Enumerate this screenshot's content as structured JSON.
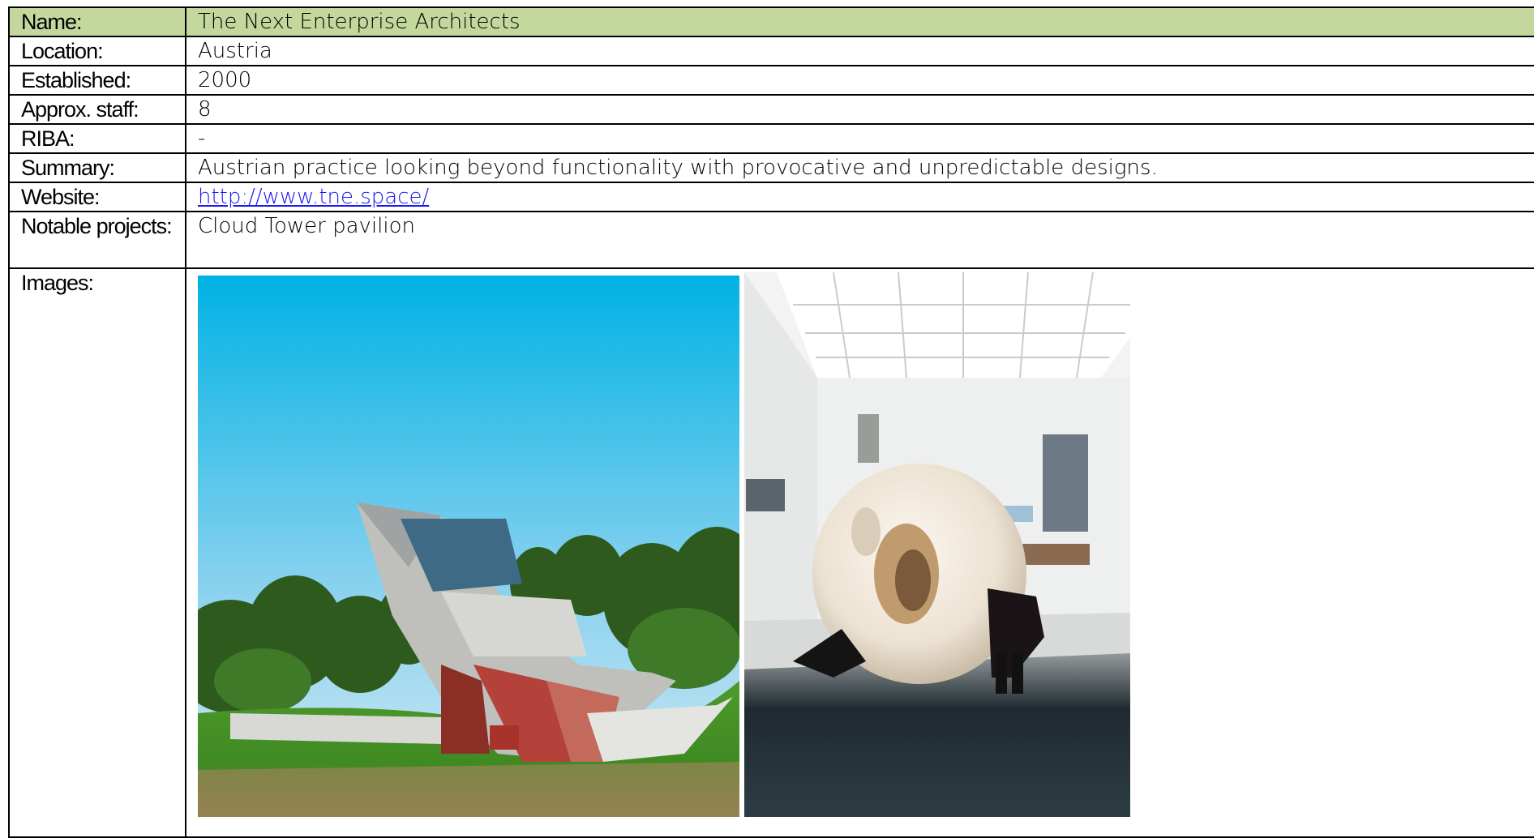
{
  "rows": {
    "name": {
      "label": "Name:",
      "value": "The Next Enterprise Architects"
    },
    "location": {
      "label": "Location:",
      "value": "Austria"
    },
    "established": {
      "label": "Established:",
      "value": "2000"
    },
    "staff": {
      "label": "Approx. staff:",
      "value": "8"
    },
    "riba": {
      "label": "RIBA:",
      "value": "-"
    },
    "summary": {
      "label": "Summary:",
      "value": "Austrian practice looking beyond functionality with provocative and unpredictable designs."
    },
    "website": {
      "label": "Website:",
      "value": "http://www.tne.space/"
    },
    "notable": {
      "label": "Notable projects:",
      "value": "Cloud Tower pavilion"
    },
    "images": {
      "label": "Images:"
    }
  },
  "colors": {
    "header_bg": "#c4d89e",
    "link": "#1a1aee",
    "border": "#000000"
  },
  "images": [
    {
      "depicts": "angular concrete pavilion with red steel supports on a grassy hill under blue sky"
    },
    {
      "depicts": "large white organic sculpture in a white gallery with people crouching under it"
    }
  ]
}
